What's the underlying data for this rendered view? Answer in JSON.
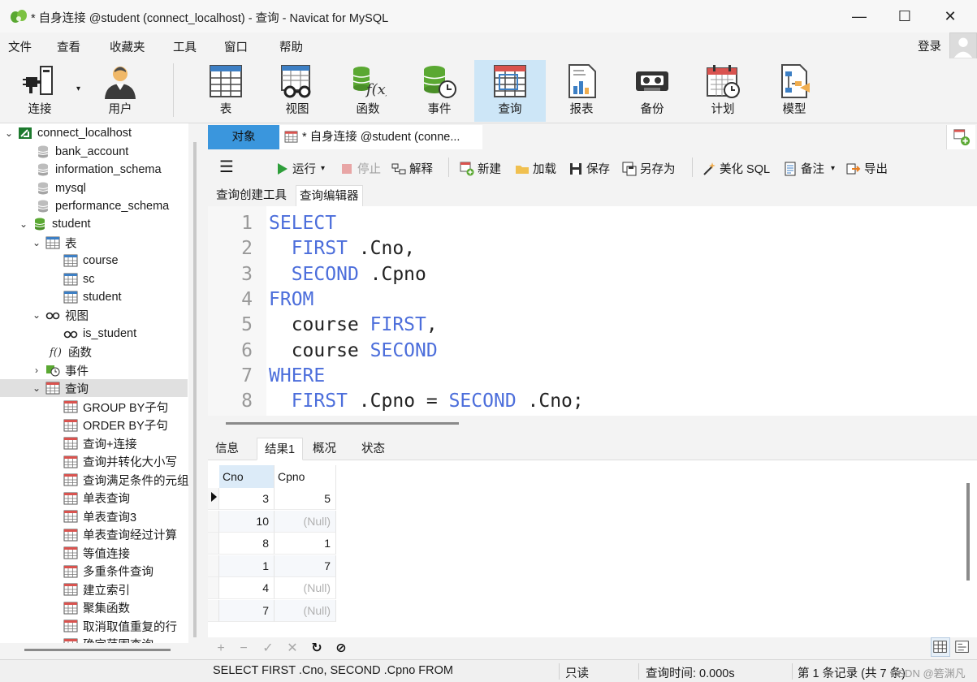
{
  "window": {
    "title": "* 自身连接 @student (connect_localhost) - 查询 - Navicat for MySQL",
    "minimize": "—",
    "maximize": "☐",
    "close": "✕"
  },
  "menu": {
    "items": [
      "文件",
      "查看",
      "收藏夹",
      "工具",
      "窗口",
      "帮助"
    ],
    "login": "登录"
  },
  "toolbar": {
    "items": [
      {
        "label": "连接",
        "icon": "plug-icon"
      },
      {
        "label": "用户",
        "icon": "user-icon"
      },
      {
        "label": "表",
        "icon": "table-icon"
      },
      {
        "label": "视图",
        "icon": "view-glasses-icon"
      },
      {
        "label": "函数",
        "icon": "function-icon"
      },
      {
        "label": "事件",
        "icon": "event-icon"
      },
      {
        "label": "查询",
        "icon": "query-icon"
      },
      {
        "label": "报表",
        "icon": "report-icon"
      },
      {
        "label": "备份",
        "icon": "backup-icon"
      },
      {
        "label": "计划",
        "icon": "schedule-icon"
      },
      {
        "label": "模型",
        "icon": "model-icon"
      }
    ]
  },
  "tree": {
    "connection": "connect_localhost",
    "databases": [
      "bank_account",
      "information_schema",
      "mysql",
      "performance_schema",
      "student"
    ],
    "tables_label": "表",
    "tables": [
      "course",
      "sc",
      "student"
    ],
    "views_label": "视图",
    "views": [
      "is_student"
    ],
    "functions_label": "函数",
    "events_label": "事件",
    "queries_label": "查询",
    "queries": [
      "GROUP BY子句",
      "ORDER BY子句",
      "查询+连接",
      "查询并转化大小写",
      "查询满足条件的元组",
      "单表查询",
      "单表查询3",
      "单表查询经过计算",
      "等值连接",
      "多重条件查询",
      "建立索引",
      "聚集函数",
      "取消取值重复的行",
      "确定范围查询"
    ]
  },
  "tabs": {
    "objects": "对象",
    "query": "* 自身连接 @student (conne..."
  },
  "query_toolbar": {
    "run": "运行",
    "stop": "停止",
    "explain": "解释",
    "new": "新建",
    "load": "加载",
    "save": "保存",
    "save_as": "另存为",
    "beautify": "美化 SQL",
    "comment": "备注",
    "export": "导出"
  },
  "subtabs": {
    "builder": "查询创建工具",
    "editor": "查询编辑器"
  },
  "editor": {
    "lines": [
      {
        "n": "1",
        "tokens": [
          {
            "t": "SELECT",
            "k": true
          }
        ]
      },
      {
        "n": "2",
        "tokens": [
          {
            "t": "  "
          },
          {
            "t": "FIRST",
            "k": true
          },
          {
            "t": " .Cno,"
          }
        ]
      },
      {
        "n": "3",
        "tokens": [
          {
            "t": "  "
          },
          {
            "t": "SECOND",
            "k": true
          },
          {
            "t": " .Cpno"
          }
        ]
      },
      {
        "n": "4",
        "tokens": [
          {
            "t": "FROM",
            "k": true
          }
        ]
      },
      {
        "n": "5",
        "tokens": [
          {
            "t": "  course "
          },
          {
            "t": "FIRST",
            "k": true
          },
          {
            "t": ","
          }
        ]
      },
      {
        "n": "6",
        "tokens": [
          {
            "t": "  course "
          },
          {
            "t": "SECOND",
            "k": true
          }
        ]
      },
      {
        "n": "7",
        "tokens": [
          {
            "t": "WHERE",
            "k": true
          }
        ]
      },
      {
        "n": "8",
        "tokens": [
          {
            "t": "  "
          },
          {
            "t": "FIRST",
            "k": true
          },
          {
            "t": " .Cpno = "
          },
          {
            "t": "SECOND",
            "k": true
          },
          {
            "t": " .Cno;"
          }
        ]
      }
    ]
  },
  "result_tabs": [
    "信息",
    "结果1",
    "概况",
    "状态"
  ],
  "grid": {
    "columns": [
      "Cno",
      "Cpno"
    ],
    "rows": [
      [
        "3",
        "5"
      ],
      [
        "10",
        "(Null)"
      ],
      [
        "8",
        "1"
      ],
      [
        "1",
        "7"
      ],
      [
        "4",
        "(Null)"
      ],
      [
        "7",
        "(Null)"
      ]
    ]
  },
  "gridnav": {
    "add": "+",
    "remove": "−",
    "apply": "✓",
    "discard": "✕",
    "refresh": "↻",
    "stop": "⊘"
  },
  "status": {
    "sql": "SELECT    FIRST .Cno,          SECOND .Cpno FROM",
    "mode": "只读",
    "time": "查询时间: 0.000s",
    "records": "第 1 条记录 (共 7 条)",
    "watermark": "CSDN @箬渊凡"
  }
}
